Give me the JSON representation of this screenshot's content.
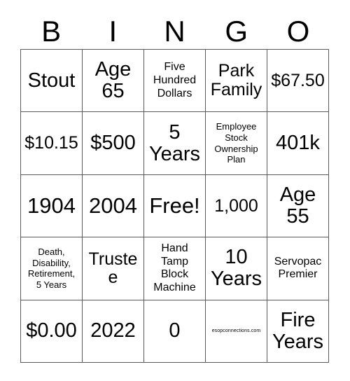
{
  "card": {
    "header_letters": [
      "B",
      "I",
      "N",
      "G",
      "O"
    ],
    "footer_note": "esopconnections.com",
    "colors": {
      "border": "#5a5a5a",
      "background": "#ffffff",
      "text": "#000000"
    },
    "rows": [
      [
        {
          "text": "Stout",
          "size": "lg"
        },
        {
          "text": "Age\n65",
          "size": "lg"
        },
        {
          "text": "Five\nHundred\nDollars",
          "size": "sm"
        },
        {
          "text": "Park\nFamily",
          "size": "md"
        },
        {
          "text": "$67.50",
          "size": "md"
        }
      ],
      [
        {
          "text": "$10.15",
          "size": "md"
        },
        {
          "text": "$500",
          "size": "lg"
        },
        {
          "text": "5\nYears",
          "size": "lg"
        },
        {
          "text": "Employee\nStock\nOwnership\nPlan",
          "size": "xs"
        },
        {
          "text": "401k",
          "size": "lg"
        }
      ],
      [
        {
          "text": "1904",
          "size": "xl"
        },
        {
          "text": "2004",
          "size": "xl"
        },
        {
          "text": "Free!",
          "size": "xl"
        },
        {
          "text": "1,000",
          "size": "md"
        },
        {
          "text": "Age\n55",
          "size": "lg"
        }
      ],
      [
        {
          "text": "Death,\nDisability,\nRetirement,\n5 Years",
          "size": "xs"
        },
        {
          "text": "Trustee",
          "size": "md"
        },
        {
          "text": "Hand\nTamp\nBlock\nMachine",
          "size": "sm"
        },
        {
          "text": "10\nYears",
          "size": "lg"
        },
        {
          "text": "Servopac\nPremier",
          "size": "sm"
        }
      ],
      [
        {
          "text": "$0.00",
          "size": "lg"
        },
        {
          "text": "2022",
          "size": "lg"
        },
        {
          "text": "0",
          "size": "lg"
        },
        {
          "text": "esopconnections.com",
          "size": "tiny"
        },
        {
          "text": "Fire\nYears",
          "size": "lg"
        }
      ]
    ]
  }
}
